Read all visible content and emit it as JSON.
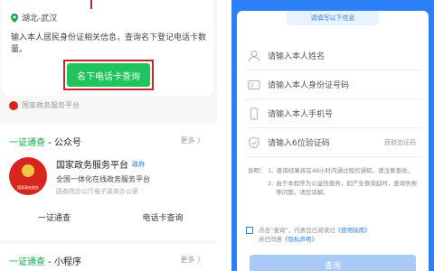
{
  "left": {
    "location": "湖北-武汉",
    "description": "输入本人居民身份证相关信息，查询名下登记电话卡数量。",
    "query_button": "名下电话卡查询",
    "source": "国家政务服务平台",
    "section1": {
      "title_prefix": "一证通查",
      "title_suffix": " - 公众号",
      "more": "更多 〉",
      "org_name": "国家政务服务平台",
      "org_badge": "政府",
      "org_line2": "全国一体化在线政务服务平台",
      "org_line3": "国务院办公厅电子政务办公室",
      "emblem_text": "国家政务服务",
      "link1": "一证通查",
      "link2": "电话卡查询"
    },
    "section2": {
      "title_prefix": "一证通查",
      "title_suffix": " - 小程序",
      "more": "更多 〉"
    }
  },
  "right": {
    "header": "请填写以下信息",
    "fields": {
      "name_placeholder": "请输入本人姓名",
      "id_placeholder": "请输入本人身份证号码",
      "phone_placeholder": "请输入本人手机号",
      "code_placeholder": "请输入6位验证码",
      "get_code": "获取验证码"
    },
    "notes": {
      "label": "说明：",
      "item1_num": "1.",
      "item1": "查询结果将在48小时内通过短信通知，请注意查收。",
      "item2_num": "2.",
      "item2": "由于本程序为公益性服务，如产生查询延时，查询失败等问题，请您谅解。"
    },
    "agreement": {
      "text_before": "点击“查询”，代表您已阅读过",
      "link1": "《使用指南》",
      "text_mid": "并已同意",
      "link2": "《隐私声明》"
    },
    "submit": "查询"
  },
  "colors": {
    "green": "#21c35d",
    "highlight_red": "#c4262e",
    "blue": "#2c80f5"
  }
}
